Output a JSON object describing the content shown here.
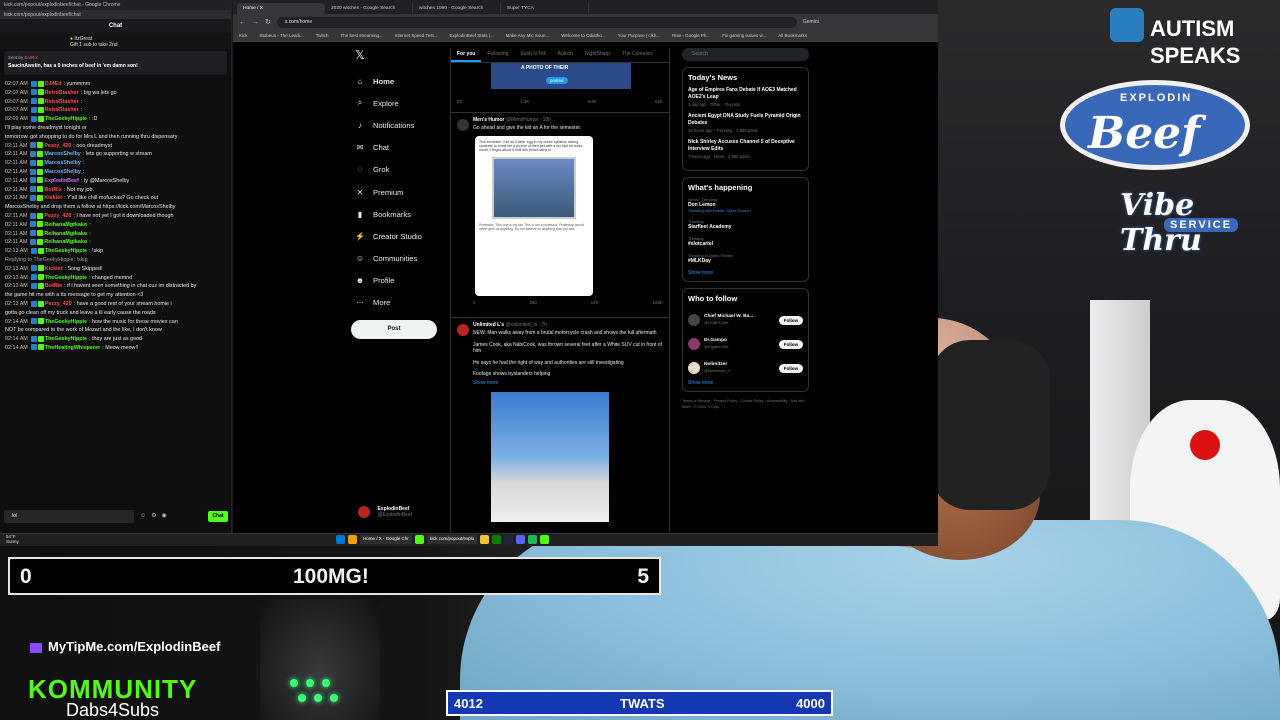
{
  "chat_window": {
    "title": "kick.com/popout/explodinbeef/chat - Google Chrome",
    "url": "kick.com/popout/explodinbeef/chat",
    "header": "Chat",
    "gift_user": "ItzGreat",
    "gift_text": "Gift 1 sub to take 2nd",
    "pinned_by": "Sent by",
    "pinned_by_user": "BotRix",
    "pinned_message": "SaucinAwstin, has a 0 inches of beef in 'em damn son!",
    "input_value": "lol",
    "send_label": "Chat",
    "messages": [
      {
        "time": "02:07 AM",
        "user": "DJ4Ed",
        "color": "#ff4b4b",
        "text": ": yummmm"
      },
      {
        "time": "02:07 AM",
        "user": "RetroStasher",
        "color": "#ff4b4b",
        "text": ": big wa lets go"
      },
      {
        "time": "02:07 AM",
        "user": "RetroStasher",
        "color": "#ff4b4b",
        "text": ":"
      },
      {
        "time": "02:07 AM",
        "user": "RetroStasher",
        "color": "#ff4b4b",
        "text": ":"
      },
      {
        "time": "02:09 AM",
        "user": "TheGeekyHippie",
        "color": "#53fc18",
        "text": ": :D"
      },
      {
        "time": "",
        "user": "",
        "color": "#e8e8e8",
        "text": "I'll play some dreadmyst tonight or"
      },
      {
        "time": "",
        "user": "",
        "color": "#e8e8e8",
        "text": "tomorrow. got shopping to do for Mrs L and then running thru dispensary"
      },
      {
        "time": "02:11 AM",
        "user": "Pezzy_420",
        "color": "#ff4b4b",
        "text": ": ooo dreadmyst"
      },
      {
        "time": "02:11 AM",
        "user": "MarcosShelby",
        "color": "#5ab4ff",
        "text": ": lets go supporting w stream"
      },
      {
        "time": "02:11 AM",
        "user": "MarcosShelby",
        "color": "#5ab4ff",
        "text": ":"
      },
      {
        "time": "02:11 AM",
        "user": "MarcosShelby",
        "color": "#5ab4ff",
        "text": ":"
      },
      {
        "time": "02:11 AM",
        "user": "ExplodinBeef",
        "color": "#c86bff",
        "text": ": ty @MarcosShelby"
      },
      {
        "time": "02:11 AM",
        "user": "BotRix",
        "color": "#ff4b4b",
        "text": ": Not my job."
      },
      {
        "time": "02:11 AM",
        "user": "Kicklet",
        "color": "#ff4b4b",
        "text": ": Y'all like chill mofuckas? Go check out"
      },
      {
        "time": "",
        "user": "",
        "color": "#e8e8e8",
        "text": "MarcosShelby and drop them a follow at https://kick.com/MarcosShelby"
      },
      {
        "time": "02:11 AM",
        "user": "Pezzy_420",
        "color": "#ff4b4b",
        "text": ": I have not yet I got it downloaded though"
      },
      {
        "time": "02:11 AM",
        "user": "ReihanaMgtkako",
        "color": "#53fc18",
        "text": ":"
      },
      {
        "time": "02:11 AM",
        "user": "ReihanaMgtkako",
        "color": "#53fc18",
        "text": ":"
      },
      {
        "time": "02:11 AM",
        "user": "ReihanaMgtkako",
        "color": "#53fc18",
        "text": ":"
      },
      {
        "time": "02:13 AM",
        "user": "TheGeekyHippie",
        "color": "#53fc18",
        "text": ": !skip"
      },
      {
        "time": "",
        "user": "",
        "color": "#9a9a9a",
        "text": "Replying to TheGeekyHippie: !skip"
      },
      {
        "time": "02:13 AM",
        "user": "Kicklet",
        "color": "#ff4b4b",
        "text": ": Song Skipped!"
      },
      {
        "time": "02:13 AM",
        "user": "TheGeekyHippie",
        "color": "#53fc18",
        "text": ": changed memnd"
      },
      {
        "time": "02:13 AM",
        "user": "BotRix",
        "color": "#ff4b4b",
        "text": ": if i havent seen something in chat cuz im distracted by"
      },
      {
        "time": "",
        "user": "",
        "color": "#e8e8e8",
        "text": "the game hit me with a tts message to get my attention <3"
      },
      {
        "time": "02:13 AM",
        "user": "Pezzy_420",
        "color": "#ff4b4b",
        "text": ": have a good rest of your stream homie i"
      },
      {
        "time": "",
        "user": "",
        "color": "#e8e8e8",
        "text": "gotta go clean off my truck and leave a lil early cause the roads"
      },
      {
        "time": "02:14 AM",
        "user": "TheGeekyHippie",
        "color": "#53fc18",
        "text": ": how the music for these movies can"
      },
      {
        "time": "",
        "user": "",
        "color": "#e8e8e8",
        "text": "NOT be compared to the work of Mozart and the like, I don't know"
      },
      {
        "time": "02:14 AM",
        "user": "TheGeekyHippie",
        "color": "#53fc18",
        "text": ": they are just as good"
      },
      {
        "time": "02:14 AM",
        "user": "TheHealingWhisperer",
        "color": "#53fc18",
        "text": ": Meow meow!!"
      }
    ]
  },
  "browser": {
    "tabs": [
      "Home / X",
      "2020 witches - Google Search",
      "witches 1990 - Google Search",
      "Super TYCA"
    ],
    "url": "x.com/home",
    "bookmarks": [
      "Kick",
      "Stobeus - The Leadi...",
      "Twitch",
      "The best streaming...",
      "Internet Speed Test...",
      "ExplodinBeef Stats |...",
      "Make Any Mic Soun...",
      "Welcome to Odiatho...",
      "Your Purpose | clkh...",
      "Rise - Google Ph...",
      "Fix gaming issues w...",
      "All Bookmarks"
    ],
    "gemini": "Gemini"
  },
  "x_nav": {
    "items": [
      {
        "icon": "home-icon",
        "label": "Home"
      },
      {
        "icon": "search-icon",
        "label": "Explore"
      },
      {
        "icon": "bell-icon",
        "label": "Notifications"
      },
      {
        "icon": "mail-icon",
        "label": "Chat"
      },
      {
        "icon": "grok-icon",
        "label": "Grok"
      },
      {
        "icon": "x-icon",
        "label": "Premium"
      },
      {
        "icon": "bookmark-icon",
        "label": "Bookmarks"
      },
      {
        "icon": "bolt-icon",
        "label": "Creator Studio"
      },
      {
        "icon": "people-icon",
        "label": "Communities"
      },
      {
        "icon": "person-icon",
        "label": "Profile"
      },
      {
        "icon": "more-icon",
        "label": "More"
      }
    ],
    "post_label": "Post",
    "profile_name": "ExplodinBeef",
    "profile_handle": "@ExplodinBeef"
  },
  "feed": {
    "tabs": [
      "For you",
      "Following",
      "Kush N Tell",
      "Autism",
      "NightSharp",
      "The Connoiss"
    ],
    "banner_text": "A PHOTO OF THEIR",
    "posted_label": "posted",
    "post0_stats": [
      "52",
      "1.3K",
      "4.8K",
      "81K"
    ],
    "post1": {
      "user": "Men's Humor",
      "handle": "@MensHumor · 18h",
      "text": "Go ahead and give the kid an A for the semester.",
      "stats": [
        "6",
        "260",
        "14K",
        "168K"
      ],
      "image_caption": "Professor: This one is my fav. This is not a professor. Professor would never give us anything. Do not believe on anything that you see.",
      "image_text": "This semester I hid an Easter egg in my online syllabus asking students to email me a picture of their pet with a fun fact for extra credit. I forgot about it until this email came in..."
    },
    "post2": {
      "user": "Unlimited L's",
      "handle": "@unlimited_ls · 7h",
      "text1": "NEW: Man walks away from a brutal motorcycle crash and shows the full aftermath",
      "text2": "James Cook, aka NabiCook, was thrown several feet after a White SUV cut in front of him",
      "text3": "He says he had the right of way and authorities are still investigating",
      "text4": "Footage shows bystanders helping",
      "more": "Show more"
    }
  },
  "right": {
    "search_placeholder": "Search",
    "news_title": "Today's News",
    "news": [
      {
        "h": "Age of Empires Fans Debate If AOE3 Matched AOE2's Leap",
        "m": "1 day ago · Other · 75 posts"
      },
      {
        "h": "Ancient Egypt DNA Study Fuels Pyramid Origin Debates",
        "m": "18 hours ago · Trending · 2,890 posts"
      },
      {
        "h": "Nick Shirley Accuses Channel 5 of Deceptive Interview Edits",
        "m": "7 hours ago · News · 2,990 posts"
      }
    ],
    "happening_title": "What's happening",
    "trends": [
      {
        "m": "News · Trending",
        "h": "Don Lemon",
        "s": "Trending with Pastor, Cities Church"
      },
      {
        "m": "Trending",
        "h": "Starfleet Academy",
        "s": ""
      },
      {
        "m": "Trending",
        "h": "#slotcartel",
        "s": ""
      },
      {
        "m": "Trending in United States",
        "h": "#MLKDay",
        "s": ""
      }
    ],
    "show_more": "Show more",
    "wtf_title": "Who to follow",
    "follow_label": "Follow",
    "wtf": [
      {
        "n": "Chief Michael W. Ba...",
        "h": "@USBPChief",
        "c": "#444"
      },
      {
        "n": "Dr.Gampo",
        "h": "@Elgamo365",
        "c": "#8a3a6a"
      },
      {
        "n": "Nolimitzer",
        "h": "@Nolimitzer_X",
        "c": "#e8d8c8"
      }
    ],
    "footer": "Terms of Service · Privacy Policy · Cookie Policy · Accessibility · Ads info · More · © 2026 X Corp."
  },
  "taskbar": {
    "temp": "54°F",
    "cond": "Sunny",
    "app1": "Home / X - Google Chr",
    "app2": "kick.com/popout/explo"
  },
  "overlay": {
    "score_left": "0",
    "score_center": "100MG!",
    "score_right": "5",
    "twats_left": "4012",
    "twats_center": "TWATS",
    "twats_right": "4000",
    "tipme": "MyTipMe.com/ExplodinBeef",
    "kommunity": "KOMMUNITY",
    "dabs": "Dabs4Subs",
    "autism_1": "AUTISM",
    "autism_2": "SPEAKS",
    "brand_explodin": "EXPLODIN",
    "brand_beef": "Beef",
    "brand_vibe": "Vibe Thru",
    "brand_service": "SERVICE"
  }
}
